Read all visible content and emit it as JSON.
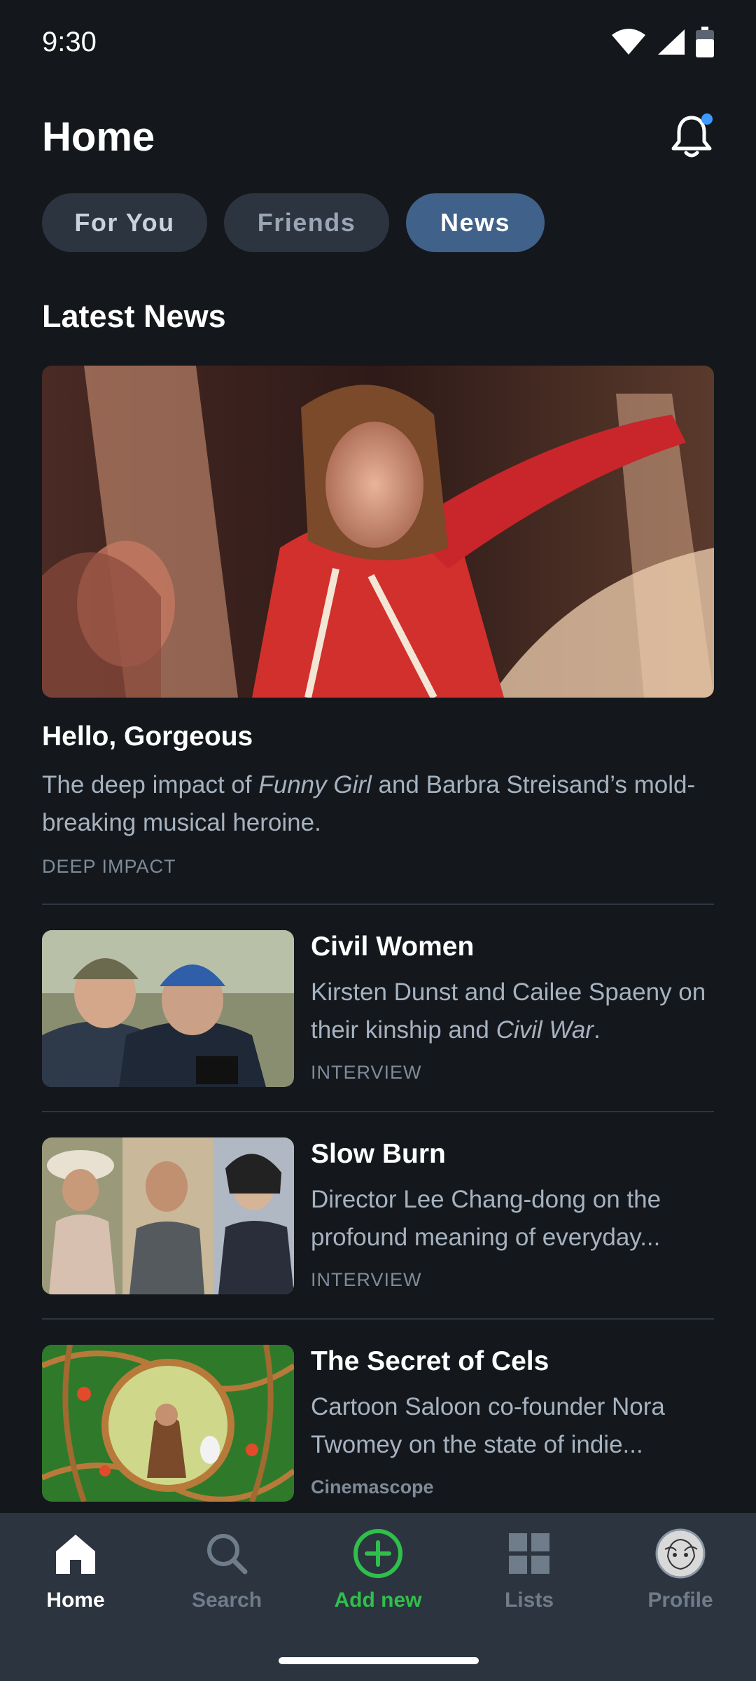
{
  "status_bar": {
    "time": "9:30"
  },
  "header": {
    "title": "Home"
  },
  "tabs": [
    {
      "label": "For You",
      "active": false
    },
    {
      "label": "Friends",
      "active": false
    },
    {
      "label": "News",
      "active": true
    }
  ],
  "section": {
    "title": "Latest News"
  },
  "featured": {
    "title": "Hello, Gorgeous",
    "desc_pre": "The deep impact of ",
    "desc_italic": "Funny Girl",
    "desc_post": " and Barbra Streisand’s mold-breaking musical heroine.",
    "tag": "DEEP IMPACT"
  },
  "articles": [
    {
      "title": "Civil Women",
      "desc_pre": "Kirsten Dunst and Cailee Spaeny on their kinship and ",
      "desc_italic": "Civil War",
      "desc_post": ".",
      "tag": "INTERVIEW"
    },
    {
      "title": "Slow Burn",
      "desc_pre": "Director Lee Chang-dong on the profound meaning of everyday...",
      "desc_italic": "",
      "desc_post": "",
      "tag": "INTERVIEW"
    },
    {
      "title": "The Secret of Cels",
      "desc_pre": "Cartoon Saloon co-founder Nora Twomey on the state of indie...",
      "desc_italic": "",
      "desc_post": "",
      "tag": "Cinemascope"
    }
  ],
  "bottom_nav": [
    {
      "label": "Home",
      "icon": "home-icon",
      "active": true
    },
    {
      "label": "Search",
      "icon": "search-icon",
      "active": false
    },
    {
      "label": "Add new",
      "icon": "add-circle-icon",
      "active": false
    },
    {
      "label": "Lists",
      "icon": "grid-icon",
      "active": false
    },
    {
      "label": "Profile",
      "icon": "avatar-icon",
      "active": false
    }
  ],
  "colors": {
    "background": "#14181c",
    "tab_active": "#40618a",
    "accent_green": "#2fbf4a",
    "notification_dot": "#3d9bff"
  }
}
